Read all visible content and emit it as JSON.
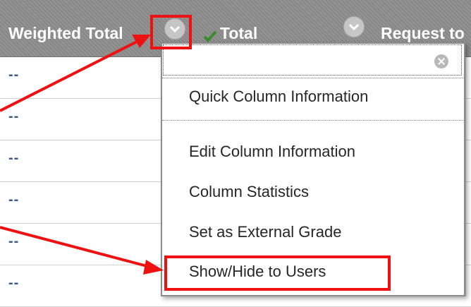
{
  "columns": {
    "weighted_total": "Weighted Total",
    "total": "Total",
    "request": "Request to"
  },
  "rows": [
    "--",
    "--",
    "--",
    "--",
    "--",
    "--"
  ],
  "menu": {
    "quick_info": "Quick Column Information",
    "edit_info": "Edit Column Information",
    "statistics": "Column Statistics",
    "external_grade": "Set as External Grade",
    "show_hide": "Show/Hide to Users"
  },
  "icons": {
    "chevron": "chevron-down-icon",
    "close": "close-icon",
    "check": "check-icon"
  },
  "colors": {
    "header": "#8e8e8e",
    "annotation": "#ee1111",
    "cell_text": "#3a5a86"
  }
}
